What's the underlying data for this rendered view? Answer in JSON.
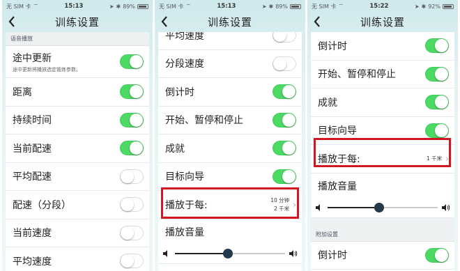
{
  "status_bar": {
    "carrier": "无 SIM 卡",
    "screens": [
      {
        "time": "15:13",
        "battery": "89%",
        "battery_level": 0.89
      },
      {
        "time": "15:13",
        "battery": "89%",
        "battery_level": 0.89
      },
      {
        "time": "15:22",
        "battery": "92%",
        "battery_level": 0.92
      }
    ]
  },
  "nav": {
    "title": "训练设置",
    "back_icon": "chevron-left-icon"
  },
  "screen1": {
    "section": "语音播放",
    "rows": [
      {
        "label": "途中更新",
        "sub": "途中更新将播放选定锻炼参数。",
        "on": true
      },
      {
        "label": "距离",
        "on": true
      },
      {
        "label": "持续时间",
        "on": true
      },
      {
        "label": "当前配速",
        "on": true
      },
      {
        "label": "平均配速",
        "on": false
      },
      {
        "label": "配速（分段）",
        "on": false
      },
      {
        "label": "当前速度",
        "on": false
      },
      {
        "label": "平均速度",
        "on": false
      }
    ]
  },
  "screen2": {
    "rows": [
      {
        "label": "平均速度",
        "on": false
      },
      {
        "label": "分段速度",
        "on": false
      },
      {
        "label": "倒计时",
        "on": true
      },
      {
        "label": "开始、暂停和停止",
        "on": true
      },
      {
        "label": "成就",
        "on": true
      },
      {
        "label": "目标向导",
        "on": true
      }
    ],
    "play_every": {
      "label": "播放于每:",
      "value_line1": "10 分钟",
      "value_line2": "2 千米"
    },
    "volume": {
      "label": "播放音量",
      "level": 0.48
    }
  },
  "screen3": {
    "rows": [
      {
        "label": "倒计时",
        "on": true
      },
      {
        "label": "开始、暂停和停止",
        "on": true
      },
      {
        "label": "成就",
        "on": true
      },
      {
        "label": "目标向导",
        "on": true
      }
    ],
    "play_every": {
      "label": "播放于每:",
      "value": "1 千米"
    },
    "volume": {
      "label": "播放音量",
      "level": 0.47
    },
    "section2": "附加设置",
    "extra_row": {
      "label": "倒计时",
      "on": true
    }
  },
  "colors": {
    "toggle_on": "#4cd964",
    "highlight": "#d0161e",
    "slider_knob": "#243a4a"
  }
}
